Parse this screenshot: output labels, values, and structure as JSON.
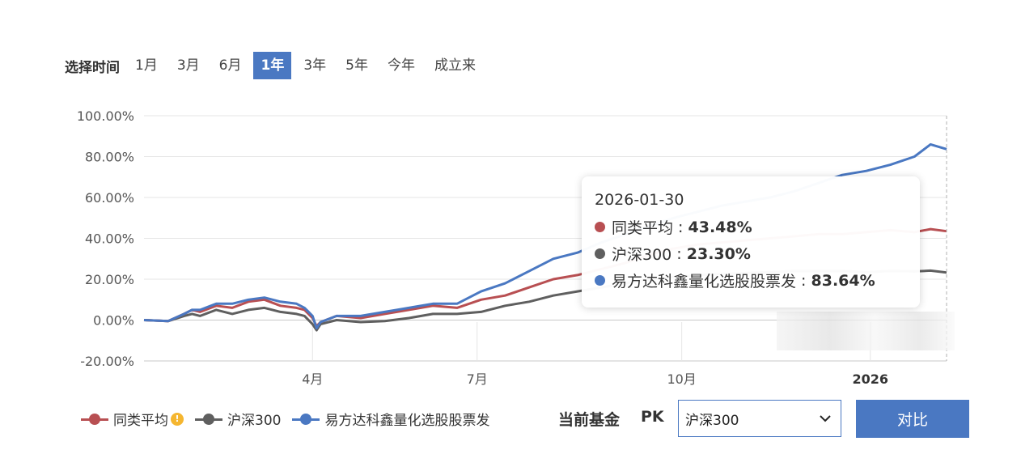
{
  "period_selector": {
    "label": "选择时间",
    "options": [
      "1月",
      "3月",
      "6月",
      "1年",
      "3年",
      "5年",
      "今年",
      "成立来"
    ],
    "active": "1年"
  },
  "tooltip": {
    "date": "2026-01-30",
    "rows": [
      {
        "name": "同类平均",
        "value": "43.48%",
        "color": "#b84f52"
      },
      {
        "name": "沪深300",
        "value": "23.30%",
        "color": "#5f5f5f"
      },
      {
        "name": "易方达科鑫量化选股股票发",
        "value": "83.64%",
        "color": "#4a78c2"
      }
    ]
  },
  "legend": {
    "items": [
      {
        "name": "同类平均",
        "color": "#b84f52",
        "icon": "warning-icon"
      },
      {
        "name": "沪深300",
        "color": "#5f5f5f"
      },
      {
        "name": "易方达科鑫量化选股股票发",
        "color": "#4a78c2"
      }
    ]
  },
  "compare": {
    "label": "当前基金",
    "pk": "PK",
    "selected": "沪深300",
    "button": "对比"
  },
  "chart_data": {
    "type": "line",
    "ylim": [
      -20,
      100
    ],
    "y_ticks": [
      "100.00%",
      "80.00%",
      "60.00%",
      "40.00%",
      "20.00%",
      "0.00%",
      "-20.00%"
    ],
    "y_tick_values": [
      100,
      80,
      60,
      40,
      20,
      0,
      -20
    ],
    "x_ticks": [
      {
        "label": "4月",
        "pos": 0.21
      },
      {
        "label": "7月",
        "pos": 0.415
      },
      {
        "label": "10月",
        "pos": 0.67
      },
      {
        "label": "2026",
        "pos": 0.905
      }
    ],
    "x": [
      0,
      0.03,
      0.05,
      0.06,
      0.07,
      0.09,
      0.11,
      0.13,
      0.15,
      0.17,
      0.19,
      0.2,
      0.21,
      0.215,
      0.22,
      0.24,
      0.27,
      0.3,
      0.33,
      0.36,
      0.39,
      0.42,
      0.45,
      0.48,
      0.51,
      0.54,
      0.57,
      0.6,
      0.63,
      0.66,
      0.69,
      0.72,
      0.75,
      0.78,
      0.81,
      0.84,
      0.87,
      0.9,
      0.93,
      0.96,
      0.98,
      1.0
    ],
    "series": [
      {
        "name": "同类平均",
        "color": "#b84f52",
        "values": [
          0,
          -0.5,
          3,
          5,
          4,
          7,
          6,
          9,
          10,
          7,
          6,
          5,
          1,
          -3,
          -1,
          2,
          1,
          3,
          5,
          7,
          6,
          10,
          12,
          16,
          20,
          22,
          25,
          28,
          32,
          35,
          37,
          38,
          39,
          40,
          41,
          42,
          42,
          43,
          44,
          43,
          44.5,
          43.48
        ]
      },
      {
        "name": "沪深300",
        "color": "#5f5f5f",
        "values": [
          0,
          -0.5,
          2,
          3,
          2,
          5,
          3,
          5,
          6,
          4,
          3,
          2,
          -2,
          -5,
          -2,
          0,
          -1,
          -0.5,
          1,
          3,
          3,
          4,
          7,
          9,
          12,
          14,
          16,
          18,
          20,
          21,
          22,
          22.5,
          23,
          23.5,
          24,
          24,
          24,
          23.5,
          24,
          23.8,
          24.2,
          23.3
        ]
      },
      {
        "name": "易方达科鑫量化选股股票发",
        "color": "#4a78c2",
        "values": [
          0,
          -0.5,
          3,
          5,
          5,
          8,
          8,
          10,
          11,
          9,
          8,
          6,
          2,
          -4,
          -1,
          2,
          2,
          4,
          6,
          8,
          8,
          14,
          18,
          24,
          30,
          33,
          38,
          42,
          46,
          50,
          53,
          56,
          58,
          60,
          63,
          67,
          71,
          73,
          76,
          80,
          86,
          83.64
        ]
      }
    ]
  }
}
